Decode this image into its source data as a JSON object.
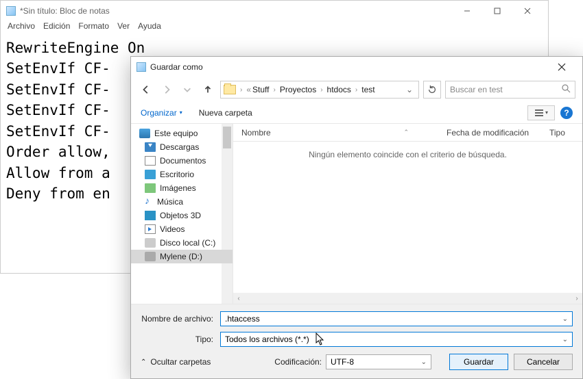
{
  "notepad": {
    "title": "*Sin título: Bloc de notas",
    "menu": {
      "archivo": "Archivo",
      "edicion": "Edición",
      "formato": "Formato",
      "ver": "Ver",
      "ayuda": "Ayuda"
    },
    "content": "RewriteEngine On\nSetEnvIf CF-\nSetEnvIf CF-\nSetEnvIf CF-\nSetEnvIf CF-\nOrder allow,\nAllow from a\nDeny from en"
  },
  "saveas": {
    "title": "Guardar como",
    "breadcrumb": {
      "pre": "«",
      "b1": "Stuff",
      "b2": "Proyectos",
      "b3": "htdocs",
      "b4": "test"
    },
    "search_placeholder": "Buscar en test",
    "organize": "Organizar",
    "new_folder": "Nueva carpeta",
    "help": "?",
    "tree": {
      "root": "Este equipo",
      "downloads": "Descargas",
      "documents": "Documentos",
      "desktop": "Escritorio",
      "images": "Imágenes",
      "music": "Música",
      "objects3d": "Objetos 3D",
      "videos": "Videos",
      "diskc": "Disco local (C:)",
      "mylene": "Mylene (D:)"
    },
    "cols": {
      "name": "Nombre",
      "date": "Fecha de modificación",
      "type": "Tipo"
    },
    "empty_msg": "Ningún elemento coincide con el criterio de búsqueda.",
    "labels": {
      "filename": "Nombre de archivo:",
      "type": "Tipo:",
      "encoding": "Codificación:"
    },
    "filename_value": ".htaccess",
    "type_value": "Todos los archivos  (*.*)",
    "encoding_value": "UTF-8",
    "hide_folders": "Ocultar carpetas",
    "save_btn": "Guardar",
    "cancel_btn": "Cancelar"
  }
}
